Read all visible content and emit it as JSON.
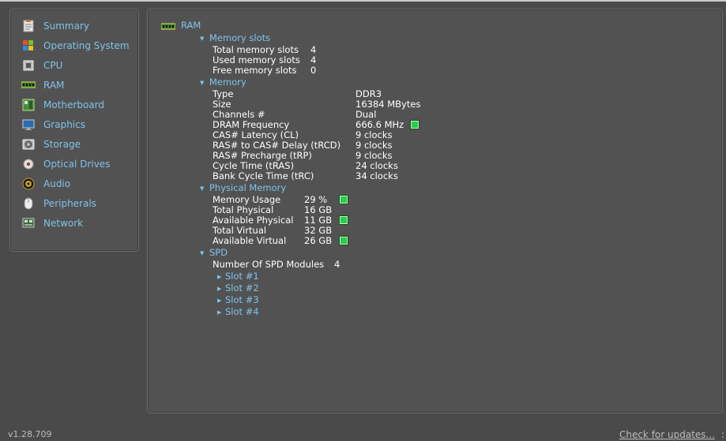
{
  "sidebar": {
    "items": [
      {
        "label": "Summary",
        "icon": "summary-icon"
      },
      {
        "label": "Operating System",
        "icon": "windows-icon"
      },
      {
        "label": "CPU",
        "icon": "cpu-icon"
      },
      {
        "label": "RAM",
        "icon": "ram-icon"
      },
      {
        "label": "Motherboard",
        "icon": "motherboard-icon"
      },
      {
        "label": "Graphics",
        "icon": "monitor-icon"
      },
      {
        "label": "Storage",
        "icon": "hdd-icon"
      },
      {
        "label": "Optical Drives",
        "icon": "disc-icon"
      },
      {
        "label": "Audio",
        "icon": "speaker-icon"
      },
      {
        "label": "Peripherals",
        "icon": "mouse-icon"
      },
      {
        "label": "Network",
        "icon": "network-icon"
      }
    ]
  },
  "main": {
    "title": "RAM",
    "memory_slots": {
      "header": "Memory slots",
      "rows": [
        {
          "label": "Total memory slots",
          "value": "4"
        },
        {
          "label": "Used memory slots",
          "value": "4"
        },
        {
          "label": "Free memory slots",
          "value": "0"
        }
      ]
    },
    "memory": {
      "header": "Memory",
      "rows": [
        {
          "label": "Type",
          "value": "DDR3"
        },
        {
          "label": "Size",
          "value": "16384 MBytes"
        },
        {
          "label": "Channels #",
          "value": "Dual"
        },
        {
          "label": "DRAM Frequency",
          "value": "666.6 MHz"
        },
        {
          "label": "CAS# Latency (CL)",
          "value": "9 clocks"
        },
        {
          "label": "RAS# to CAS# Delay (tRCD)",
          "value": "9 clocks"
        },
        {
          "label": "RAS# Precharge (tRP)",
          "value": "9 clocks"
        },
        {
          "label": "Cycle Time (tRAS)",
          "value": "24 clocks"
        },
        {
          "label": "Bank Cycle Time (tRC)",
          "value": "34 clocks"
        }
      ]
    },
    "physical_memory": {
      "header": "Physical Memory",
      "rows": [
        {
          "label": "Memory Usage",
          "value": "29 %"
        },
        {
          "label": "Total Physical",
          "value": "16 GB"
        },
        {
          "label": "Available Physical",
          "value": "11 GB"
        },
        {
          "label": "Total Virtual",
          "value": "32 GB"
        },
        {
          "label": "Available Virtual",
          "value": "26 GB"
        }
      ]
    },
    "spd": {
      "header": "SPD",
      "modules_label": "Number Of SPD Modules",
      "modules_value": "4",
      "slots": [
        "Slot #1",
        "Slot #2",
        "Slot #3",
        "Slot #4"
      ]
    }
  },
  "footer": {
    "version": "v1.28.709",
    "update_link": "Check for updates...",
    "tail": ":"
  },
  "colors": {
    "background": "#4a4a4a",
    "panel": "#525252",
    "accent": "#7fc3ea",
    "indicator": "#22d04a"
  }
}
